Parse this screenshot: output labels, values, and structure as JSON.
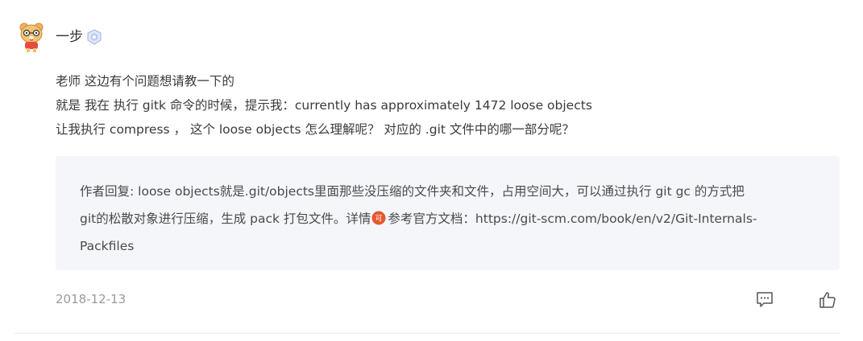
{
  "comment": {
    "author": "一步",
    "avatar_icon": "cartoon-bear-avatar",
    "badge_icon": "level-shield-badge-icon",
    "lines": [
      "老师 这边有个问题想请教一下的",
      "就是 我在 执行 gitk 命令的时候，提示我：currently has approximately 1472 loose objects",
      "让我执行 compress ， 这个 loose objects 怎么理解呢？ 对应的 .git 文件中的哪一部分呢？"
    ],
    "reply": {
      "line1": "作者回复: loose objects就是.git/objects里面那些没压缩的文件夹和文件，占用空间大，可以通过执行 git gc 的方式把",
      "line2_before": "git的松散对象进行压缩，生成 pack 打包文件。详情",
      "inline_icon_glyph": "可",
      "line2_after": "参考官方文档：https://git-scm.com/book/en/v2/Git-Internals-",
      "line3": "Packfiles"
    },
    "date": "2018-12-13",
    "reply_action_icon": "comment-icon",
    "like_action_icon": "thumbs-up-icon"
  },
  "colors": {
    "reply_background": "#f5f6fa",
    "inline_icon": "#e8572d",
    "meta_text": "#9a9a9a"
  }
}
